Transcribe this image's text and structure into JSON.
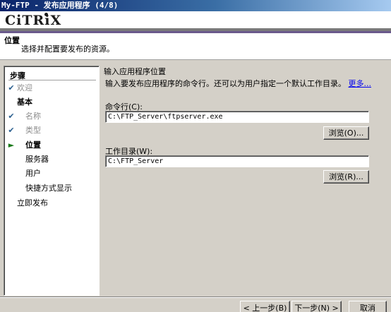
{
  "window": {
    "title": "My-FTP - 发布应用程序 (4/8)"
  },
  "header": {
    "logo": "CiTRiX",
    "title": "位置",
    "subtitle": "选择并配置要发布的资源。"
  },
  "steps": {
    "heading": "步骤",
    "items": [
      {
        "label": "欢迎",
        "state": "done"
      },
      {
        "label": "基本",
        "state": "section"
      },
      {
        "label": "名称",
        "state": "done"
      },
      {
        "label": "类型",
        "state": "done"
      },
      {
        "label": "位置",
        "state": "current"
      },
      {
        "label": "服务器",
        "state": "pending"
      },
      {
        "label": "用户",
        "state": "pending"
      },
      {
        "label": "快捷方式显示",
        "state": "pending"
      },
      {
        "label": "立即发布",
        "state": "pending-top"
      }
    ]
  },
  "content": {
    "title": "输入应用程序位置",
    "description": "输入要发布应用程序的命令行。还可以为用户指定一个默认工作目录。",
    "more_link": "更多...",
    "command_label": "命令行(C):",
    "command_value": "C:\\FTP_Server\\ftpserver.exe",
    "browse1_label": "浏览(O)...",
    "workdir_label": "工作目录(W):",
    "workdir_value": "C:\\FTP_Server",
    "browse2_label": "浏览(R)..."
  },
  "footer": {
    "back_label": "< 上一步(B)",
    "next_label": "下一步(N) >",
    "cancel_label": "取消"
  },
  "colors": {
    "titlebar_start": "#0a246a",
    "brand_purple": "#6a5a8c",
    "link": "#0000ee",
    "check": "#2a5f8f",
    "current_arrow": "#1a7a1a"
  }
}
